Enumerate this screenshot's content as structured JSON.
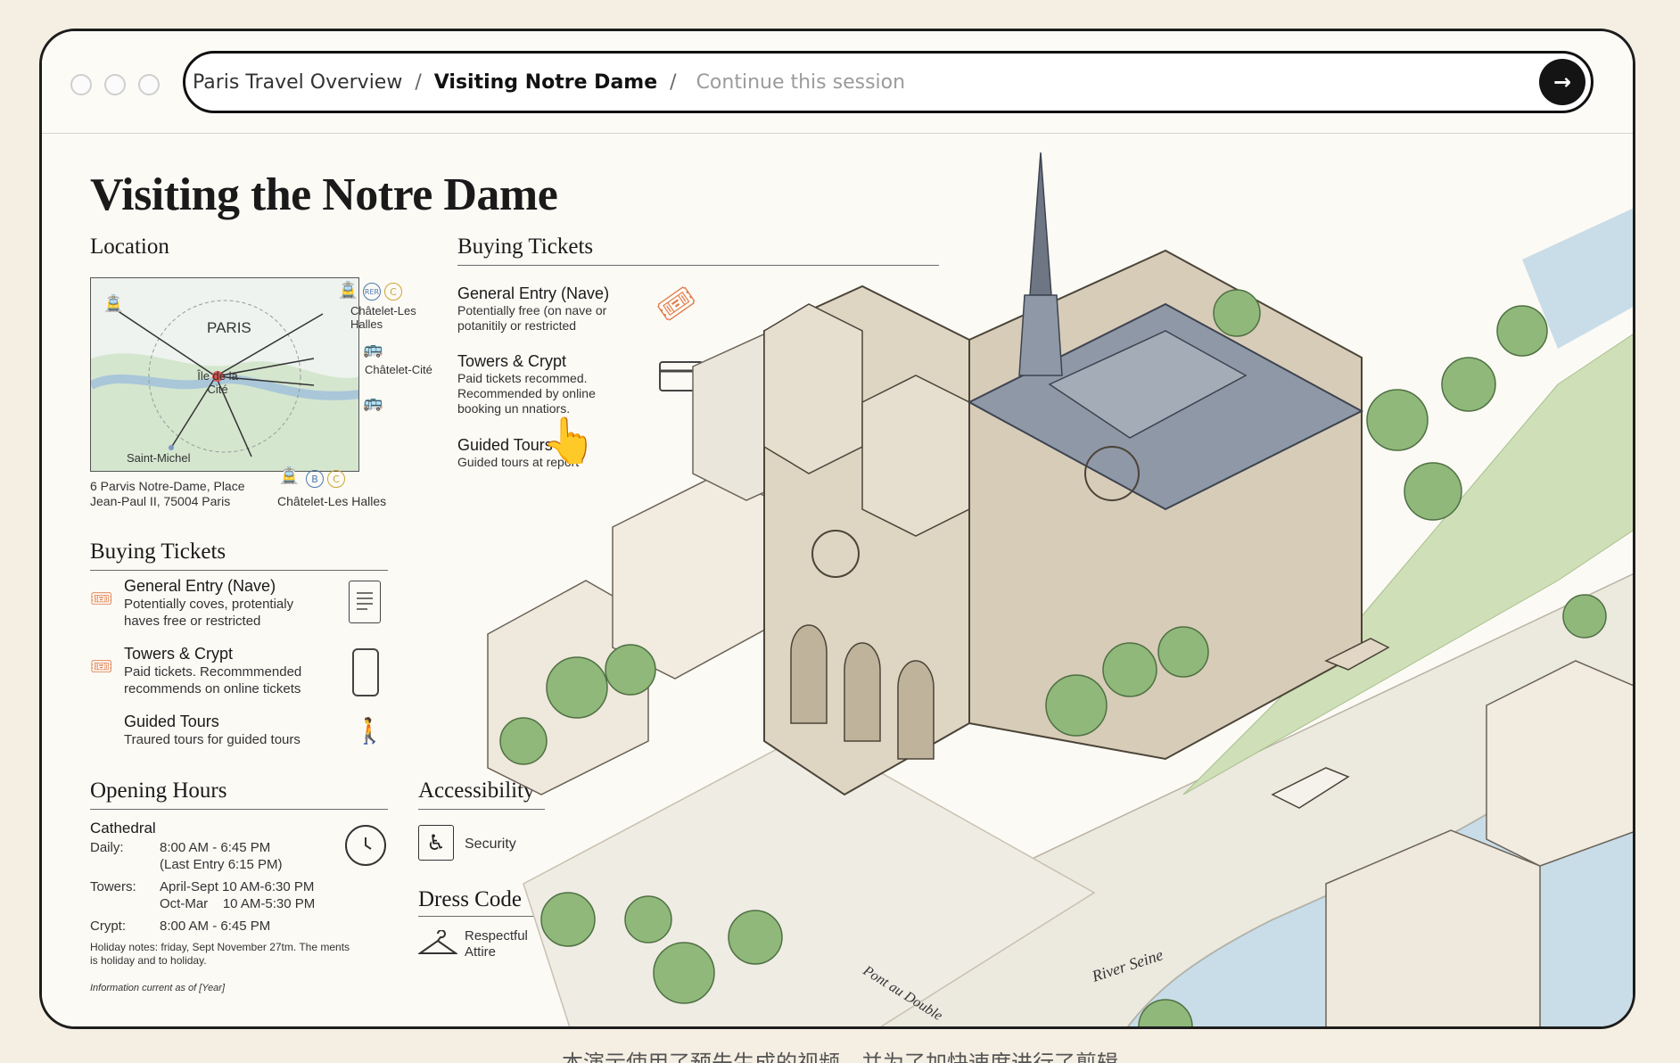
{
  "breadcrumb": {
    "items": [
      "Paris Travel Overview",
      "Visiting Notre Dame"
    ],
    "separator": "/",
    "placeholder": "Continue this session",
    "go_icon": "arrow-right-icon"
  },
  "page": {
    "title": "Visiting the Notre Dame",
    "location": {
      "heading": "Location",
      "map_labels": {
        "paris": "PARIS",
        "ile": "Île de la Cité",
        "saint_michel": "Saint-Michel",
        "chatelet_halles_top": "Châtelet-Les Halles",
        "chatelet_cite": "Châtelet-Cité",
        "chatelet_halles_bottom": "Châtelet-Les Halles",
        "rer": "RER",
        "b": "B",
        "c": "C"
      },
      "address": "6 Parvis Notre-Dame, Place Jean-Paul II, 75004 Paris"
    },
    "buying_tickets_left": {
      "heading": "Buying Tickets",
      "items": [
        {
          "title": "General Entry (Nave)",
          "desc": "Potentially coves, protentialy haves free or restricted",
          "icon": "receipt-icon"
        },
        {
          "title": "Towers & Crypt",
          "desc": "Paid tickets. Recommmended recommends on online tickets",
          "icon": "phone-icon"
        },
        {
          "title": "Guided Tours",
          "desc": "Traured tours for guided tours",
          "icon": "walking-person-icon"
        }
      ]
    },
    "buying_tickets_top": {
      "heading": "Buying Tickets",
      "items": [
        {
          "title": "General Entry (Nave)",
          "desc": "Potentially free (on nave or potanitily or restricted"
        },
        {
          "title": "Towers & Crypt",
          "desc": "Paid tickets recommed. Recommended by online booking un nnatiors."
        },
        {
          "title": "Guided Tours",
          "desc": "Guided tours at report"
        }
      ]
    },
    "opening_hours": {
      "heading": "Opening Hours",
      "cathedral": "Cathedral",
      "rows": [
        {
          "label": "Daily:",
          "value": "8:00 AM - 6:45 PM",
          "value2": "(Last Entry 6:15 PM)"
        },
        {
          "label": "Towers:",
          "value": "April-Sept 10 AM-6:30 PM",
          "value2": "Oct-Mar    10 AM-5:30 PM"
        },
        {
          "label": "Crypt:",
          "value": "8:00 AM - 6:45 PM",
          "value2": ""
        }
      ],
      "holiday_note": "Holiday notes: friday, Sept November 27tm. The ments is holiday and to holiday.",
      "info_current": "Information current as of [Year]"
    },
    "accessibility": {
      "heading": "Accessibility",
      "item": "Security"
    },
    "dress_code": {
      "heading": "Dress Code",
      "item": "Respectful Attire"
    },
    "illustration_labels": {
      "river": "River Seine",
      "bridge": "Pont au Double"
    }
  },
  "caption": "本演示使用了预先生成的视频，并为了加快速度进行了剪辑"
}
